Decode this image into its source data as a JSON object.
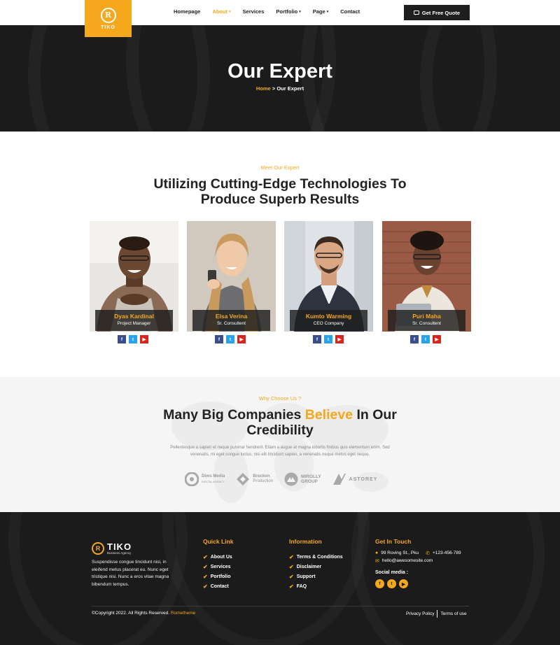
{
  "brand": {
    "logo_text": "TIKO",
    "logo_mark": "R",
    "footer_tagline": "Business Agency",
    "accent": "#f5a81c",
    "dark": "#1b1b1b"
  },
  "nav": {
    "items": [
      {
        "label": "Homepage",
        "dropdown": false,
        "active": false
      },
      {
        "label": "About",
        "dropdown": true,
        "active": true
      },
      {
        "label": "Services",
        "dropdown": false,
        "active": false
      },
      {
        "label": "Portfolio",
        "dropdown": true,
        "active": false
      },
      {
        "label": "Page",
        "dropdown": true,
        "active": false
      },
      {
        "label": "Contact",
        "dropdown": false,
        "active": false
      }
    ],
    "cta_label": "Get Free Quote",
    "cta_icon": "chat-icon"
  },
  "hero": {
    "title": "Our Expert",
    "breadcrumb_home": "Home",
    "breadcrumb_sep": ">",
    "breadcrumb_current": "Our Expert"
  },
  "experts": {
    "eyebrow": "Meet Our Expert",
    "title_line1": "Utilizing Cutting-Edge Technologies To",
    "title_line2": "Produce Superb Results",
    "members": [
      {
        "name": "Dyas Kardinal",
        "role": "Project Manager"
      },
      {
        "name": "Elsa Verina",
        "role": "Sr. Consultent"
      },
      {
        "name": "Kumto Warming",
        "role": "CEO Company"
      },
      {
        "name": "Puri Maha",
        "role": "Sr. Consultent"
      }
    ],
    "social_icons": [
      "facebook-icon",
      "twitter-icon",
      "youtube-icon"
    ]
  },
  "why": {
    "eyebrow": "Why Choose Us ?",
    "title_pre": "Many Big Companies ",
    "title_highlight": "Believe",
    "title_post": " In Our",
    "title_line2": "Credibility",
    "text_line1": "Pellentesque a sapien et neque pulvinar hendrerit. Etiam a augue at magna lobortis finibus quis elementum enim. Sed",
    "text_line2": "venenatis, mi eget congue luctus, nisi elit tincidunt sapien, a venenatis neque metus eget neque.",
    "brands": [
      {
        "line1": "Dims Media",
        "line2": "DIGITAL AGENCY"
      },
      {
        "line1": "Brocken",
        "line2": "Production"
      },
      {
        "line1": "MIROLLY",
        "line2": "GROUP"
      },
      {
        "line1": "ASTOREY",
        "line2": ""
      }
    ]
  },
  "footer": {
    "about": "Suspendisse congue tincidunt nisi, in eleifend metus placerat eu. Nunc eget tristique nisi. Nunc a eros vitae magna bibendum tempus.",
    "quick_title": "Quick Link",
    "quick_links": [
      "About Us",
      "Services",
      "Portfolio",
      "Contact"
    ],
    "info_title": "Information",
    "info_links": [
      "Terms & Conditions",
      "Disclaimer",
      "Support",
      "FAQ"
    ],
    "touch_title": "Get In Touch",
    "address": "99 Roving St., Pku",
    "phone": "+123-456-789",
    "email": "hello@awesomesite.com",
    "social_label": "Social media :",
    "copyright": "©Copyright 2022. All Rights Reserved.",
    "copyright_brand": "Rometheme",
    "privacy": "Privacy Policy",
    "terms": "Terms of use"
  }
}
